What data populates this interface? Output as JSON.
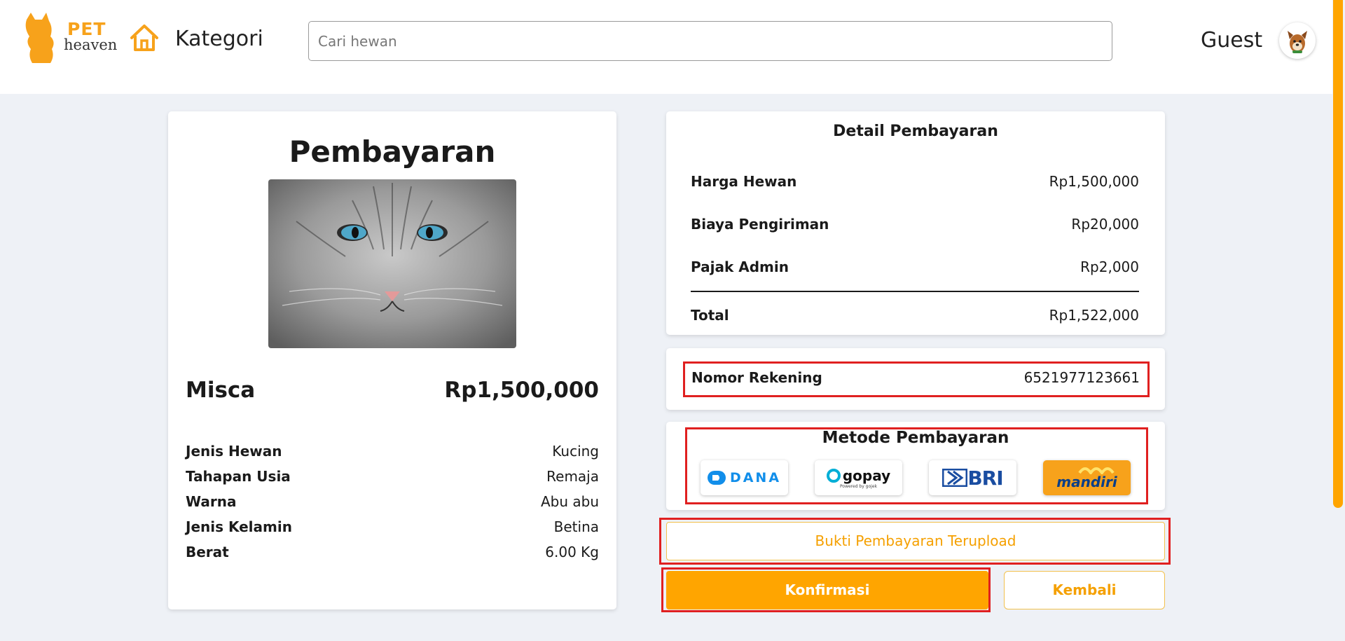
{
  "header": {
    "logo": {
      "brand_top": "PET",
      "brand_bottom": "heaven"
    },
    "nav_kategori": "Kategori",
    "search_placeholder": "Cari hewan",
    "user_name": "Guest"
  },
  "colors": {
    "accent": "#ffa500",
    "highlight": "#e02020",
    "bg": "#eef1f6"
  },
  "pet": {
    "page_title": "Pembayaran",
    "name": "Misca",
    "price": "Rp1,500,000",
    "attributes": [
      {
        "label": "Jenis Hewan",
        "value": "Kucing"
      },
      {
        "label": "Tahapan Usia",
        "value": "Remaja"
      },
      {
        "label": "Warna",
        "value": "Abu abu"
      },
      {
        "label": "Jenis Kelamin",
        "value": "Betina"
      },
      {
        "label": "Berat",
        "value": "6.00 Kg"
      }
    ]
  },
  "detail": {
    "title": "Detail Pembayaran",
    "rows": [
      {
        "label": "Harga Hewan",
        "value": "Rp1,500,000"
      },
      {
        "label": "Biaya Pengiriman",
        "value": "Rp20,000"
      },
      {
        "label": "Pajak Admin",
        "value": "Rp2,000"
      }
    ],
    "total": {
      "label": "Total",
      "value": "Rp1,522,000"
    }
  },
  "rekening": {
    "label": "Nomor Rekening",
    "value": "6521977123661"
  },
  "metode": {
    "title": "Metode Pembayaran",
    "options": [
      "DANA",
      "gopay",
      "BRI",
      "mandiri"
    ],
    "gopay_sub": "Powered by gojek"
  },
  "buttons": {
    "upload": "Bukti Pembayaran Terupload",
    "confirm": "Konfirmasi",
    "back": "Kembali"
  }
}
